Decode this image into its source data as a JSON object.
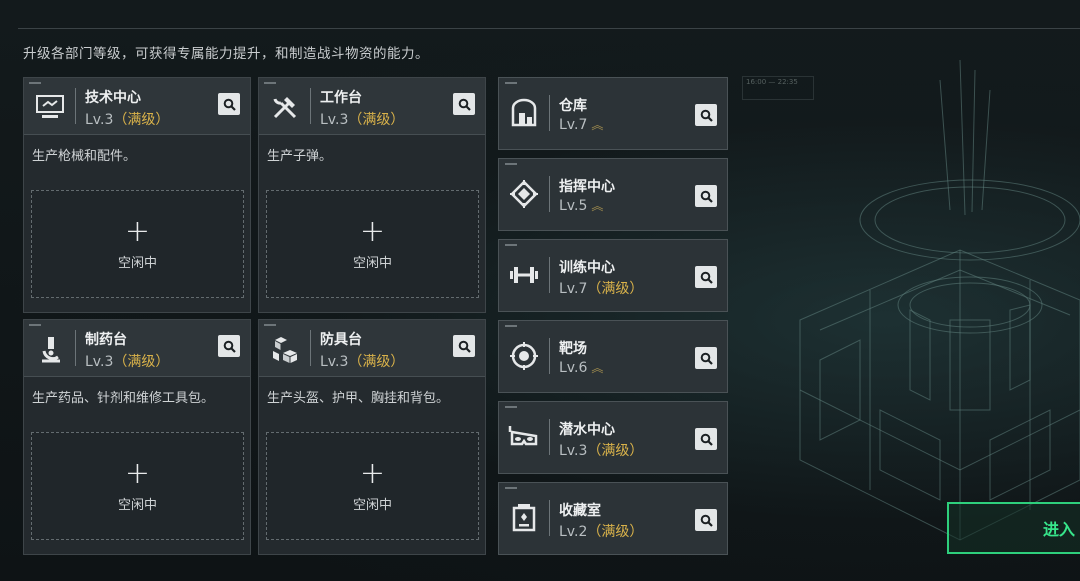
{
  "subtitle": "升级各部门等级，可获得专属能力提升，和制造战斗物资的能力。",
  "slot_plus": "+",
  "slot_idle": "空闲中",
  "max_tag": "（满级）",
  "upgrade_icon": "double-chevron-up",
  "cards": [
    {
      "name": "技术中心",
      "level": "Lv.3",
      "desc": "生产枪械和配件。",
      "icon": "monitor-icon"
    },
    {
      "name": "工作台",
      "level": "Lv.3",
      "desc": "生产子弹。",
      "icon": "tools-icon"
    },
    {
      "name": "制药台",
      "level": "Lv.3",
      "desc": "生产药品、针剂和维修工具包。",
      "icon": "microscope-icon"
    },
    {
      "name": "防具台",
      "level": "Lv.3",
      "desc": "生产头盔、护甲、胸挂和背包。",
      "icon": "cubes-icon"
    }
  ],
  "small_cards": [
    {
      "name": "仓库",
      "level": "Lv.7",
      "status": "upgrade",
      "icon": "warehouse-icon"
    },
    {
      "name": "指挥中心",
      "level": "Lv.5",
      "status": "upgrade",
      "icon": "chip-icon"
    },
    {
      "name": "训练中心",
      "level": "Lv.7",
      "status": "max",
      "icon": "dumbbell-icon"
    },
    {
      "name": "靶场",
      "level": "Lv.6",
      "status": "upgrade",
      "icon": "target-icon"
    },
    {
      "name": "潜水中心",
      "level": "Lv.3",
      "status": "max",
      "icon": "goggles-icon"
    },
    {
      "name": "收藏室",
      "level": "Lv.2",
      "status": "max",
      "icon": "collection-icon"
    }
  ],
  "enter_button": "进入",
  "deco_text": "16:00 — 22:35",
  "colors": {
    "accent_green": "#37e58b",
    "max_gold": "#d9b24a",
    "upgrade_gold": "#a08c4e"
  }
}
